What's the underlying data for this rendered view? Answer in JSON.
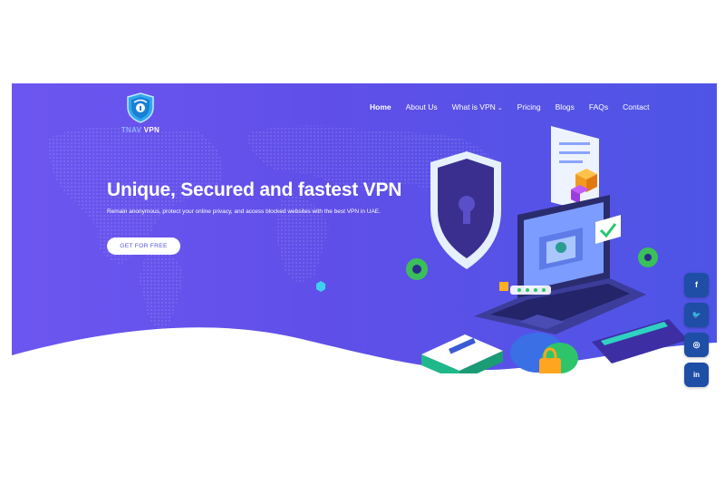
{
  "brand": {
    "name_prefix": "TNAV",
    "name_suffix": "VPN"
  },
  "nav": {
    "items": [
      {
        "label": "Home",
        "active": true
      },
      {
        "label": "About Us"
      },
      {
        "label": "What is VPN",
        "has_dropdown": true
      },
      {
        "label": "Pricing"
      },
      {
        "label": "Blogs"
      },
      {
        "label": "FAQs"
      },
      {
        "label": "Contact"
      }
    ]
  },
  "hero": {
    "headline": "Unique, Secured and fastest VPN",
    "subtext": "Remain anonymous, protect your online privacy, and access blocked websites with the best VPN in UAE.",
    "cta_label": "GET FOR FREE"
  },
  "social": [
    {
      "icon": "facebook-icon",
      "glyph": "f"
    },
    {
      "icon": "twitter-icon",
      "glyph": "🐦"
    },
    {
      "icon": "instagram-icon",
      "glyph": "◎"
    },
    {
      "icon": "linkedin-icon",
      "glyph": "in"
    }
  ],
  "colors": {
    "hero_gradient_start": "#6d56f0",
    "hero_gradient_end": "#4e55e6",
    "social_button": "#1e4ea6",
    "cta_text": "#5b54e6"
  }
}
